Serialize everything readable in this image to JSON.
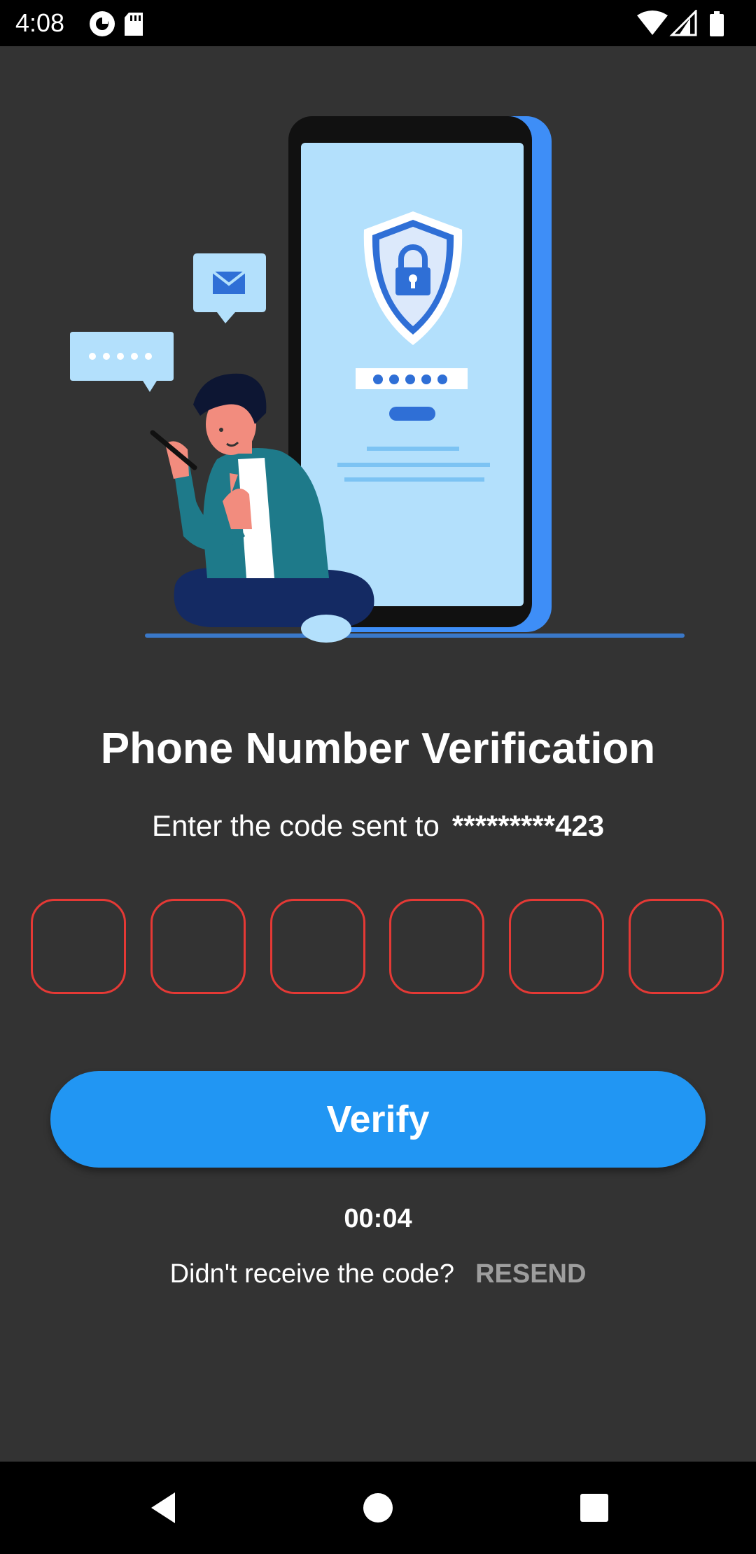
{
  "status_bar": {
    "time": "4:08",
    "left_icons": [
      "pocket-casts-icon",
      "sd-card-icon"
    ],
    "right_icons": [
      "wifi-icon",
      "cellular-signal-icon",
      "battery-icon"
    ]
  },
  "hero": {
    "illustration": "person-with-phone-security-illustration",
    "password_mask": "•••••"
  },
  "main": {
    "title": "Phone Number Verification",
    "subtitle": "Enter the code sent to",
    "phone_number": "*********423",
    "otp_fields": [
      "",
      "",
      "",
      "",
      "",
      ""
    ],
    "verify_label": "Verify",
    "timer": "00:04",
    "resend_prompt": "Didn't receive the code?",
    "resend_label": "RESEND"
  },
  "colors": {
    "background": "#333333",
    "accent": "#2196f3",
    "otp_border": "#e53935",
    "resend_disabled": "#9e9e9e"
  },
  "nav_bar": {
    "buttons": [
      "back-icon",
      "home-icon",
      "recents-icon"
    ]
  }
}
